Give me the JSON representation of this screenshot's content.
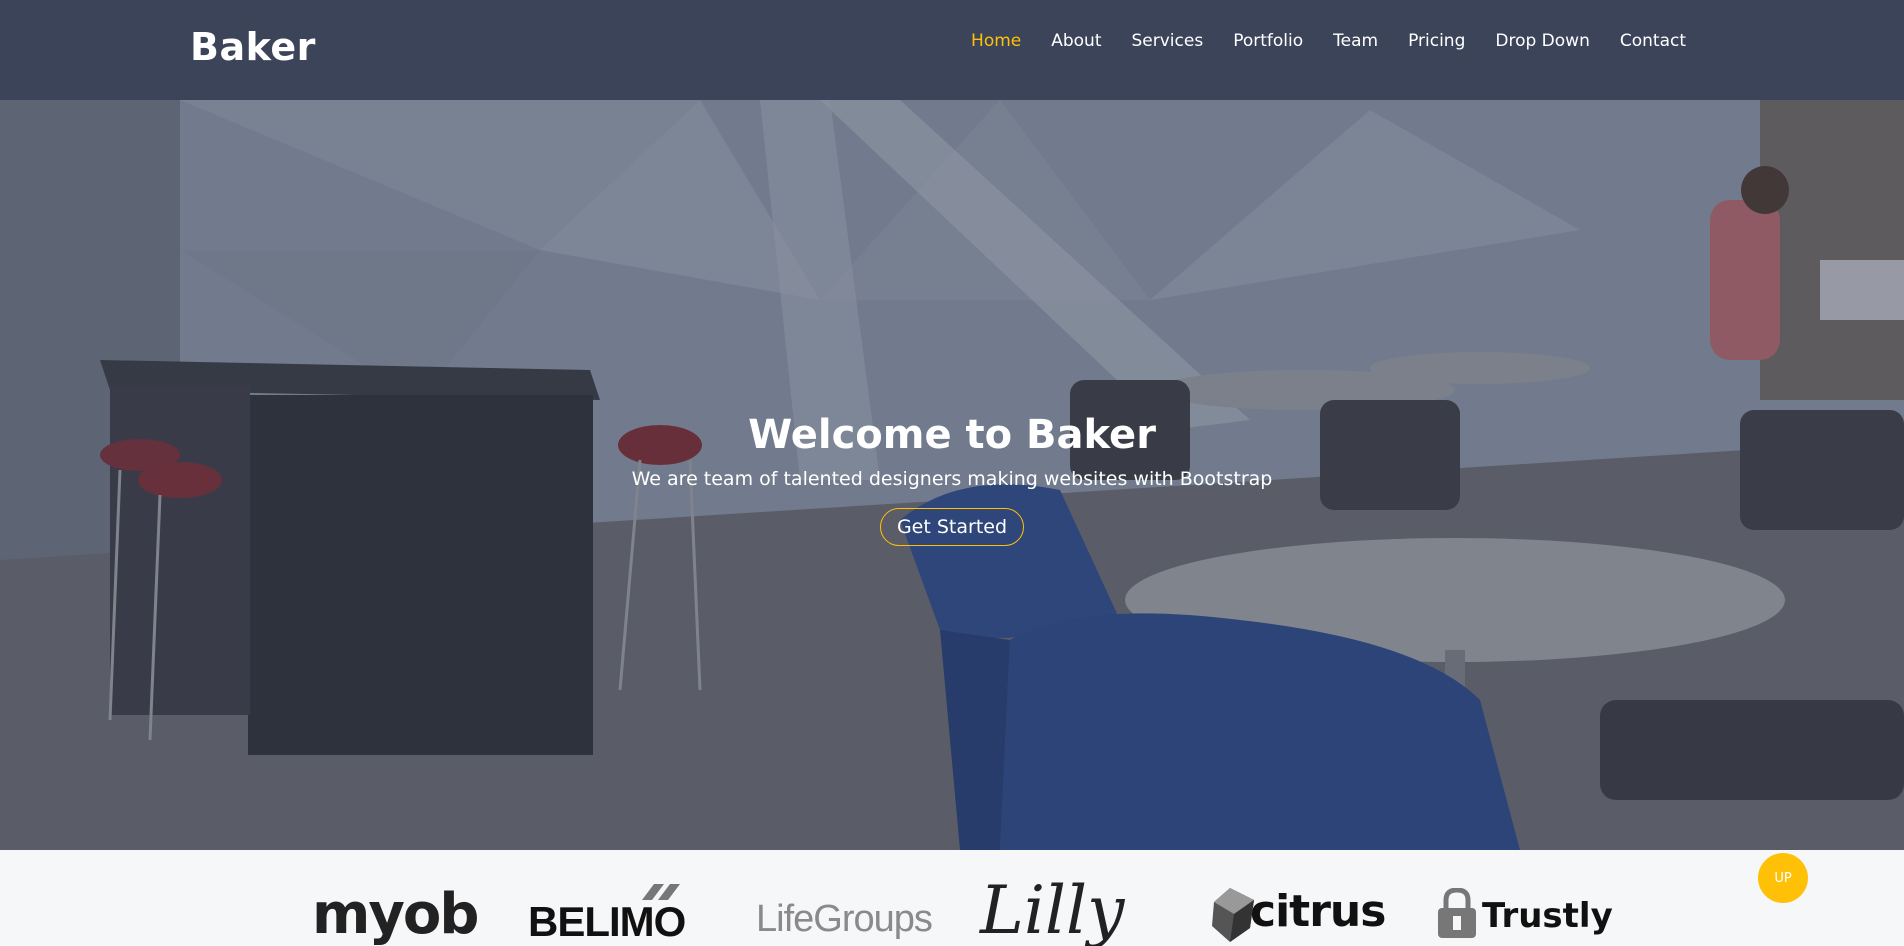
{
  "header": {
    "logo": "Baker",
    "nav": [
      {
        "label": "Home",
        "active": true
      },
      {
        "label": "About"
      },
      {
        "label": "Services"
      },
      {
        "label": "Portfolio"
      },
      {
        "label": "Team"
      },
      {
        "label": "Pricing"
      },
      {
        "label": "Drop Down"
      },
      {
        "label": "Contact"
      }
    ]
  },
  "hero": {
    "title": "Welcome to Baker",
    "subtitle": "We are team of talented designers making websites with Bootstrap",
    "cta": "Get Started"
  },
  "clients": [
    "myob",
    "BELIMO",
    "LifeGroups",
    "Lilly",
    "citrus",
    "Trustly"
  ],
  "back_to_top": "UP",
  "colors": {
    "accent": "#ffc107",
    "header_bg": "#384056",
    "text_light": "#ffffff"
  }
}
